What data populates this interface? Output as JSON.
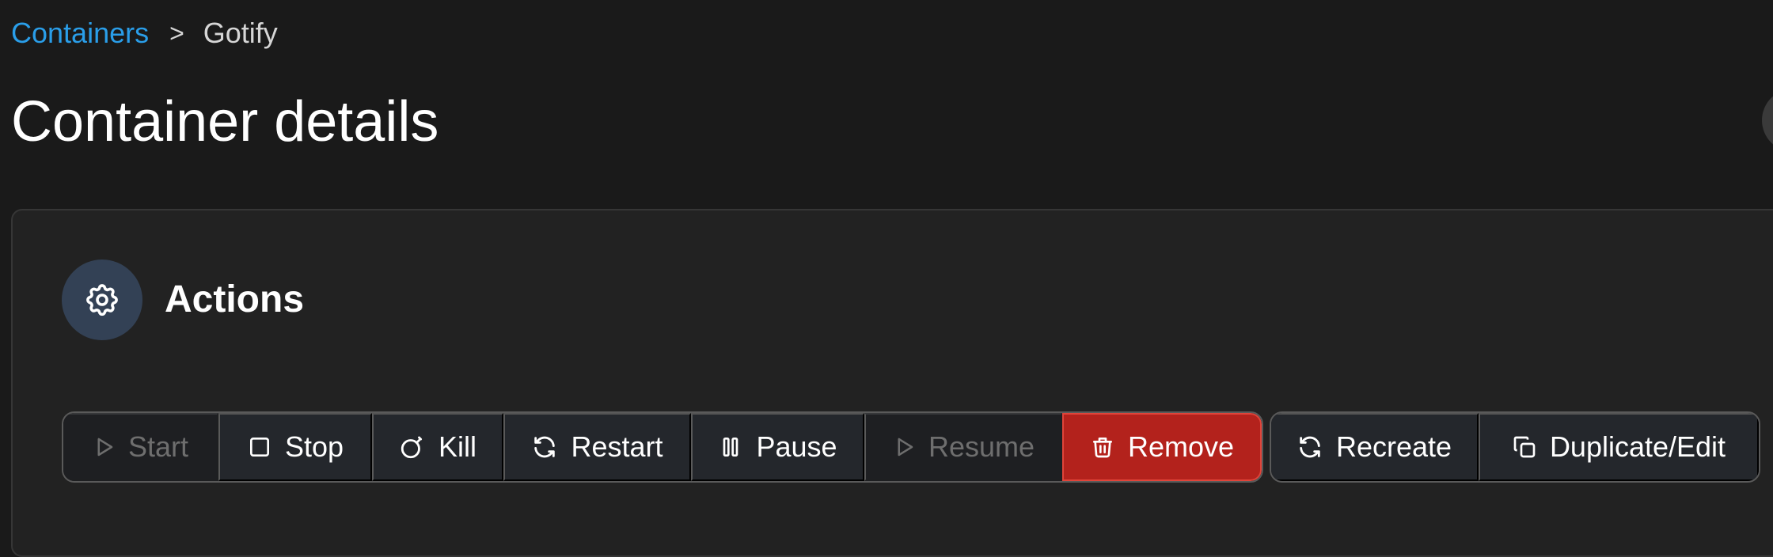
{
  "breadcrumb": {
    "parent": "Containers",
    "separator": ">",
    "current": "Gotify"
  },
  "page": {
    "title": "Container details"
  },
  "actions_panel": {
    "title": "Actions",
    "icon": "gear-icon",
    "primary_buttons": [
      {
        "label": "Start",
        "icon": "play-icon",
        "state": "disabled"
      },
      {
        "label": "Stop",
        "icon": "stop-icon",
        "state": "enabled"
      },
      {
        "label": "Kill",
        "icon": "bomb-icon",
        "state": "enabled"
      },
      {
        "label": "Restart",
        "icon": "refresh-icon",
        "state": "enabled"
      },
      {
        "label": "Pause",
        "icon": "pause-icon",
        "state": "enabled"
      },
      {
        "label": "Resume",
        "icon": "play-icon",
        "state": "disabled"
      },
      {
        "label": "Remove",
        "icon": "trash-icon",
        "state": "danger"
      }
    ],
    "secondary_buttons": [
      {
        "label": "Recreate",
        "icon": "refresh-icon",
        "state": "enabled"
      },
      {
        "label": "Duplicate/Edit",
        "icon": "copy-icon",
        "state": "enabled"
      }
    ]
  },
  "colors": {
    "background": "#1a1a1a",
    "panel": "#222222",
    "link": "#2a9ee9",
    "danger": "#b3221c",
    "icon_circle": "#334155"
  }
}
